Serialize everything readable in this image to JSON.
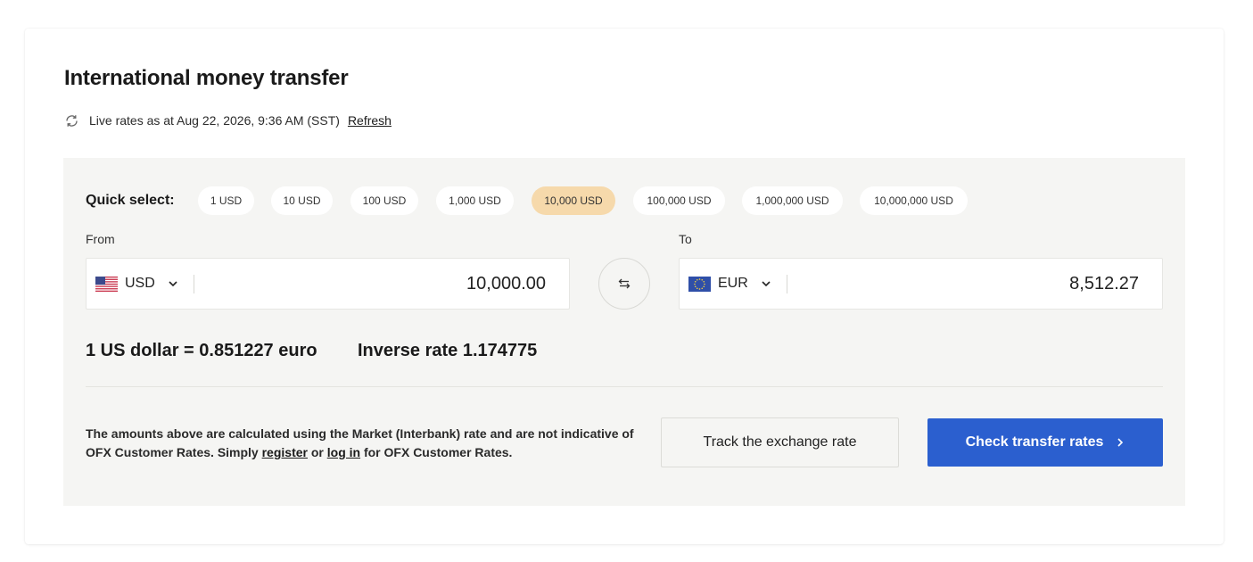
{
  "page": {
    "title": "International money transfer",
    "live_rates_text": "Live rates as at Aug 22, 2026, 9:36 AM (SST)",
    "refresh_label": "Refresh",
    "refresh_icon": "refresh-icon"
  },
  "quick_select": {
    "label": "Quick select:",
    "options": [
      "1 USD",
      "10 USD",
      "100 USD",
      "1,000 USD",
      "10,000 USD",
      "100,000 USD",
      "1,000,000 USD",
      "10,000,000 USD"
    ],
    "selected": "10,000 USD"
  },
  "from": {
    "label": "From",
    "currency": "USD",
    "flag_icon": "us-flag-icon",
    "amount": "10,000.00"
  },
  "to": {
    "label": "To",
    "currency": "EUR",
    "flag_icon": "eu-flag-icon",
    "amount": "8,512.27"
  },
  "swap_icon": "swap-icon",
  "rates": {
    "rate_text": "1 US dollar = 0.851227 euro",
    "inverse_text": "Inverse rate 1.174775"
  },
  "disclaimer": {
    "line_part1": "The amounts above are calculated using the Market (Interbank) rate and are not indicative of OFX Customer Rates. Simply ",
    "register": "register",
    "or": " or ",
    "login": "log in",
    "line_part2": " for OFX Customer Rates."
  },
  "buttons": {
    "track": "Track the exchange rate",
    "check": "Check transfer rates"
  },
  "colors": {
    "panel_bg": "#f5f5f3",
    "selected_chip": "#f6d9ab",
    "primary_button": "#2b5fcf"
  }
}
